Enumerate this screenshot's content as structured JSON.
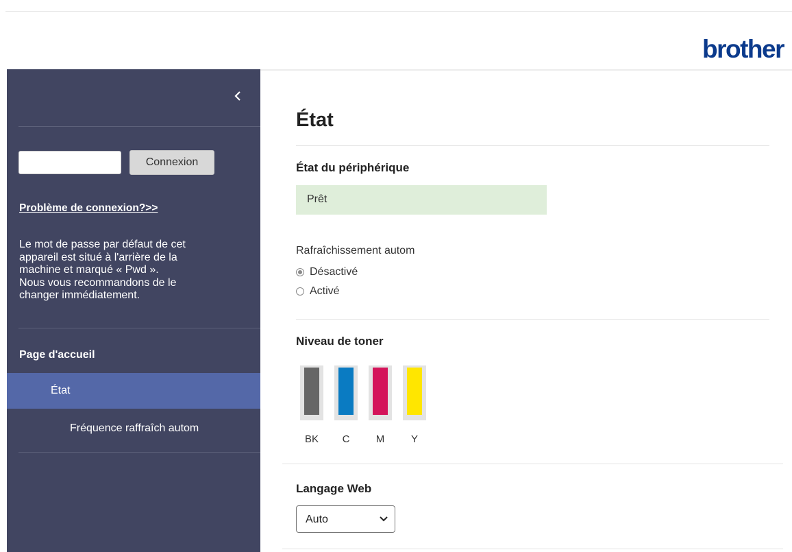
{
  "header": {
    "brand": "brother"
  },
  "sidebar": {
    "password_placeholder": "",
    "login_button": "Connexion",
    "login_problem_link": "Problème de connexion?>>",
    "notice_lines": [
      "Le mot de passe par défaut de cet",
      "appareil est situé à l'arrière de la",
      "machine et marqué « Pwd ».",
      "Nous vous recommandons de le",
      "changer immédiatement."
    ],
    "nav": {
      "home": "Page d'accueil",
      "status": "État",
      "refresh_freq": "Fréquence raffraîch autom"
    }
  },
  "main": {
    "title": "État",
    "device_status": {
      "heading": "État du périphérique",
      "value": "Prêt",
      "color": "#dfeeda"
    },
    "auto_refresh": {
      "label": "Rafraîchissement autom",
      "options": [
        {
          "label": "Désactivé",
          "selected": true
        },
        {
          "label": "Activé",
          "selected": false
        }
      ]
    },
    "toner": {
      "heading": "Niveau de toner",
      "items": [
        {
          "label": "BK",
          "color": "#666666",
          "level": 1.0
        },
        {
          "label": "C",
          "color": "#0a7bc2",
          "level": 1.0
        },
        {
          "label": "M",
          "color": "#d4145a",
          "level": 1.0
        },
        {
          "label": "Y",
          "color": "#ffe600",
          "level": 1.0
        }
      ]
    },
    "web_language": {
      "heading": "Langage Web",
      "selected": "Auto",
      "icon": "chevron-down-icon"
    }
  },
  "colors": {
    "sidebar_bg": "#414561",
    "nav_active": "#5468a8",
    "brand": "#0b3a8c"
  }
}
